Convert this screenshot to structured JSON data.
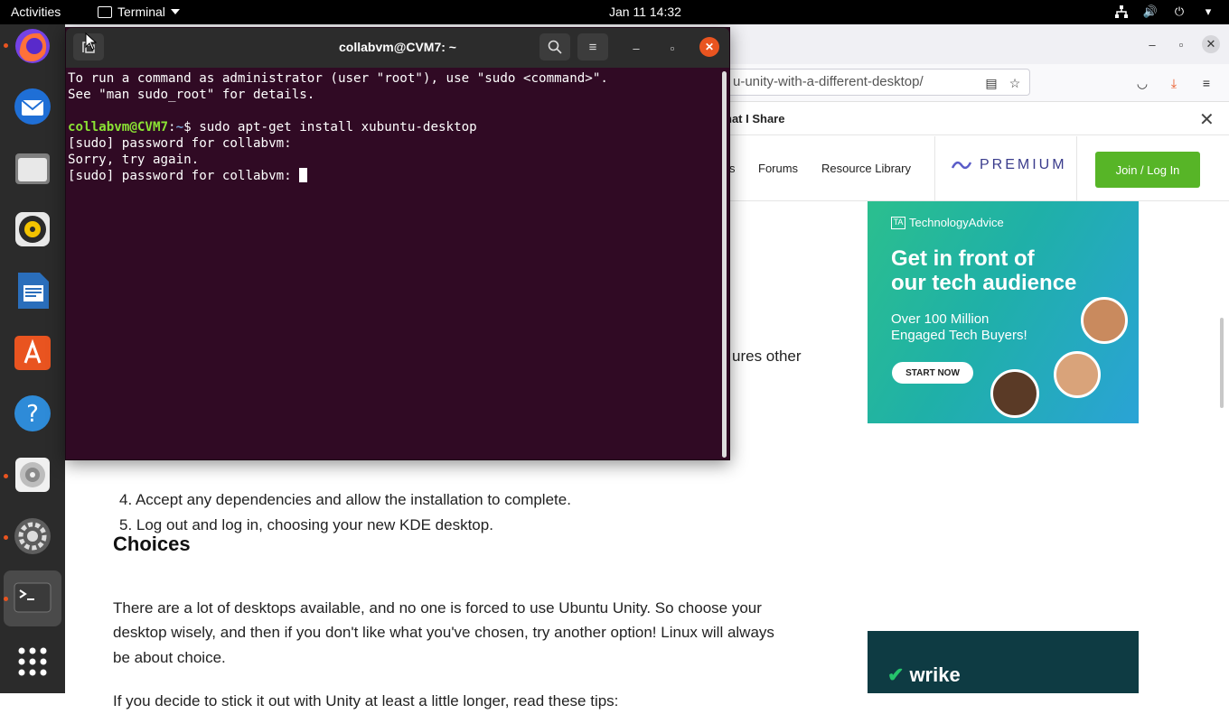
{
  "topbar": {
    "activities": "Activities",
    "app_name": "Terminal",
    "clock": "Jan 11  14:32"
  },
  "dock": {
    "items": [
      "Firefox",
      "Thunderbird",
      "Files",
      "Rhythmbox",
      "LibreOffice Writer",
      "Ubuntu Software",
      "Help",
      "Disks",
      "Settings",
      "Terminal",
      "Show Applications"
    ]
  },
  "browser": {
    "url": "u-unity-with-a-different-desktop/",
    "notification": "hat I Share",
    "nav": {
      "partial": "s",
      "forums": "Forums",
      "resource_library": "Resource Library",
      "premium": "PREMIUM",
      "join": "Join / Log In"
    },
    "article": {
      "fragment": "ures other",
      "step4": "4. Accept any dependencies and allow the installation to complete.",
      "step5": "5. Log out and log in, choosing your new KDE desktop.",
      "heading": "Choices",
      "para1_l1": "There are a lot of desktops available, and no one is forced to use Ubuntu Unity. So choose your",
      "para1_l2": "desktop wisely, and then if you don't like what you've chosen, try another option! Linux will always",
      "para1_l3": "be about choice.",
      "para2": "If you decide to stick it out with Unity at least a little longer, read these tips:"
    },
    "ad1": {
      "brand": "TechnologyAdvice",
      "brand_mark": "TA",
      "headline_l1": "Get in front of",
      "headline_l2": "our tech audience",
      "sub_l1": "Over 100 Million",
      "sub_l2": "Engaged Tech Buyers!",
      "cta": "START NOW"
    },
    "ad2": {
      "brand": "wrike"
    }
  },
  "terminal": {
    "title": "collabvm@CVM7: ~",
    "line1": "To run a command as administrator (user \"root\"), use \"sudo <command>\".",
    "line2": "See \"man sudo_root\" for details.",
    "prompt_user": "collabvm@CVM7",
    "prompt_sep": ":",
    "prompt_path": "~",
    "prompt_cmd": "$ sudo apt-get install xubuntu-desktop",
    "line4": "[sudo] password for collabvm:",
    "line5": "Sorry, try again.",
    "line6": "[sudo] password for collabvm: "
  },
  "colors": {
    "ubuntu_orange": "#e95420",
    "terminal_bg": "#300a24",
    "join_green": "#57b527"
  }
}
